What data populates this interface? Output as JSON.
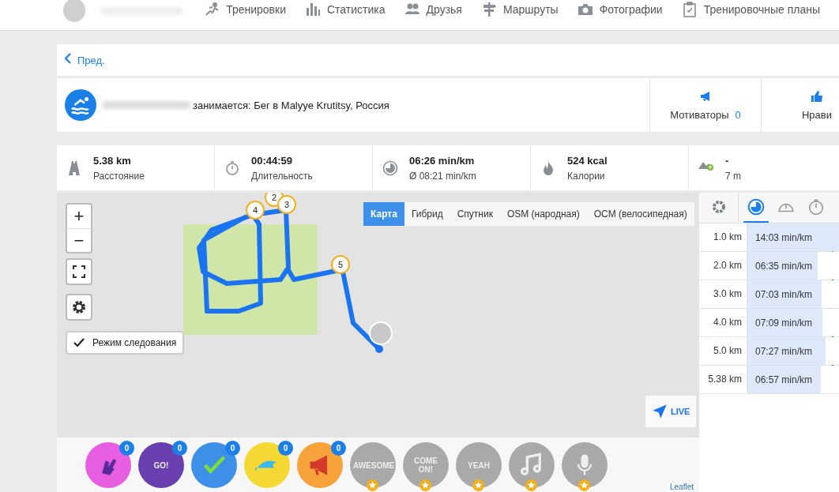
{
  "nav": {
    "items": [
      {
        "label": "Тренировки"
      },
      {
        "label": "Статистика"
      },
      {
        "label": "Друзья"
      },
      {
        "label": "Маршруты"
      },
      {
        "label": "Фотографии"
      },
      {
        "label": "Тренировочные планы"
      }
    ]
  },
  "back": {
    "label": "Пред."
  },
  "activity": {
    "text": "занимается: Бег в Malyye Krutitsy, Россия",
    "actions": [
      {
        "label": "Мотиваторы",
        "count": "0"
      },
      {
        "label": "Нрави"
      }
    ]
  },
  "stats": [
    {
      "value": "5.38 km",
      "label": "Расстояние"
    },
    {
      "value": "00:44:59",
      "label": "Длительность"
    },
    {
      "value": "06:26 min/km",
      "label": "Ø 08:21 min/km"
    },
    {
      "value": "524 kcal",
      "label": "Калории"
    },
    {
      "value": "-",
      "label": "7 m"
    }
  ],
  "map": {
    "layers": [
      {
        "label": "Карта",
        "selected": true
      },
      {
        "label": "Гибрид",
        "selected": false
      },
      {
        "label": "Спутник",
        "selected": false
      },
      {
        "label": "OSM (народная)",
        "selected": false
      },
      {
        "label": "ОСМ (велосипедная)",
        "selected": false
      }
    ],
    "zoom_in": "+",
    "zoom_out": "−",
    "follow": {
      "label": "Режим следования",
      "checked": true
    },
    "markers": [
      {
        "label": "4"
      },
      {
        "label": "2"
      },
      {
        "label": "3"
      },
      {
        "label": "5"
      }
    ],
    "live": "LIVE",
    "attribution": "Leaflet"
  },
  "stickers": [
    {
      "kind": "counted",
      "color": "#e85ee0",
      "count": "0"
    },
    {
      "kind": "counted",
      "color": "#6a3fb0",
      "count": "0",
      "text": "GO!"
    },
    {
      "kind": "counted",
      "color": "#3d8fe8",
      "count": "0"
    },
    {
      "kind": "counted",
      "color": "#f6d835",
      "count": "0"
    },
    {
      "kind": "counted",
      "color": "#f7a23a",
      "count": "0"
    },
    {
      "kind": "locked",
      "color": "#a9a9a9",
      "text": "AWESOME"
    },
    {
      "kind": "locked",
      "color": "#a9a9a9",
      "text": "COME ON!"
    },
    {
      "kind": "locked",
      "color": "#a9a9a9",
      "text": "YEAH"
    },
    {
      "kind": "locked",
      "color": "#a9a9a9"
    },
    {
      "kind": "locked",
      "color": "#a9a9a9"
    }
  ],
  "splits": {
    "tabs": [
      {
        "selected": false
      },
      {
        "selected": true
      },
      {
        "selected": false
      },
      {
        "selected": false
      }
    ],
    "rows": [
      {
        "distance": "1.0 km",
        "pace": "14:03 min/km",
        "level": 1
      },
      {
        "distance": "2.0 km",
        "pace": "06:35 min/km",
        "level": 0.77
      },
      {
        "distance": "3.0 km",
        "pace": "07:03 min/km",
        "level": 0.81
      },
      {
        "distance": "4.0 km",
        "pace": "07:09 min/km",
        "level": 0.82
      },
      {
        "distance": "5.0 km",
        "pace": "07:27 min/km",
        "level": 0.85
      },
      {
        "distance": "5.38 km",
        "pace": "06:57 min/km",
        "level": 0.8
      }
    ]
  }
}
